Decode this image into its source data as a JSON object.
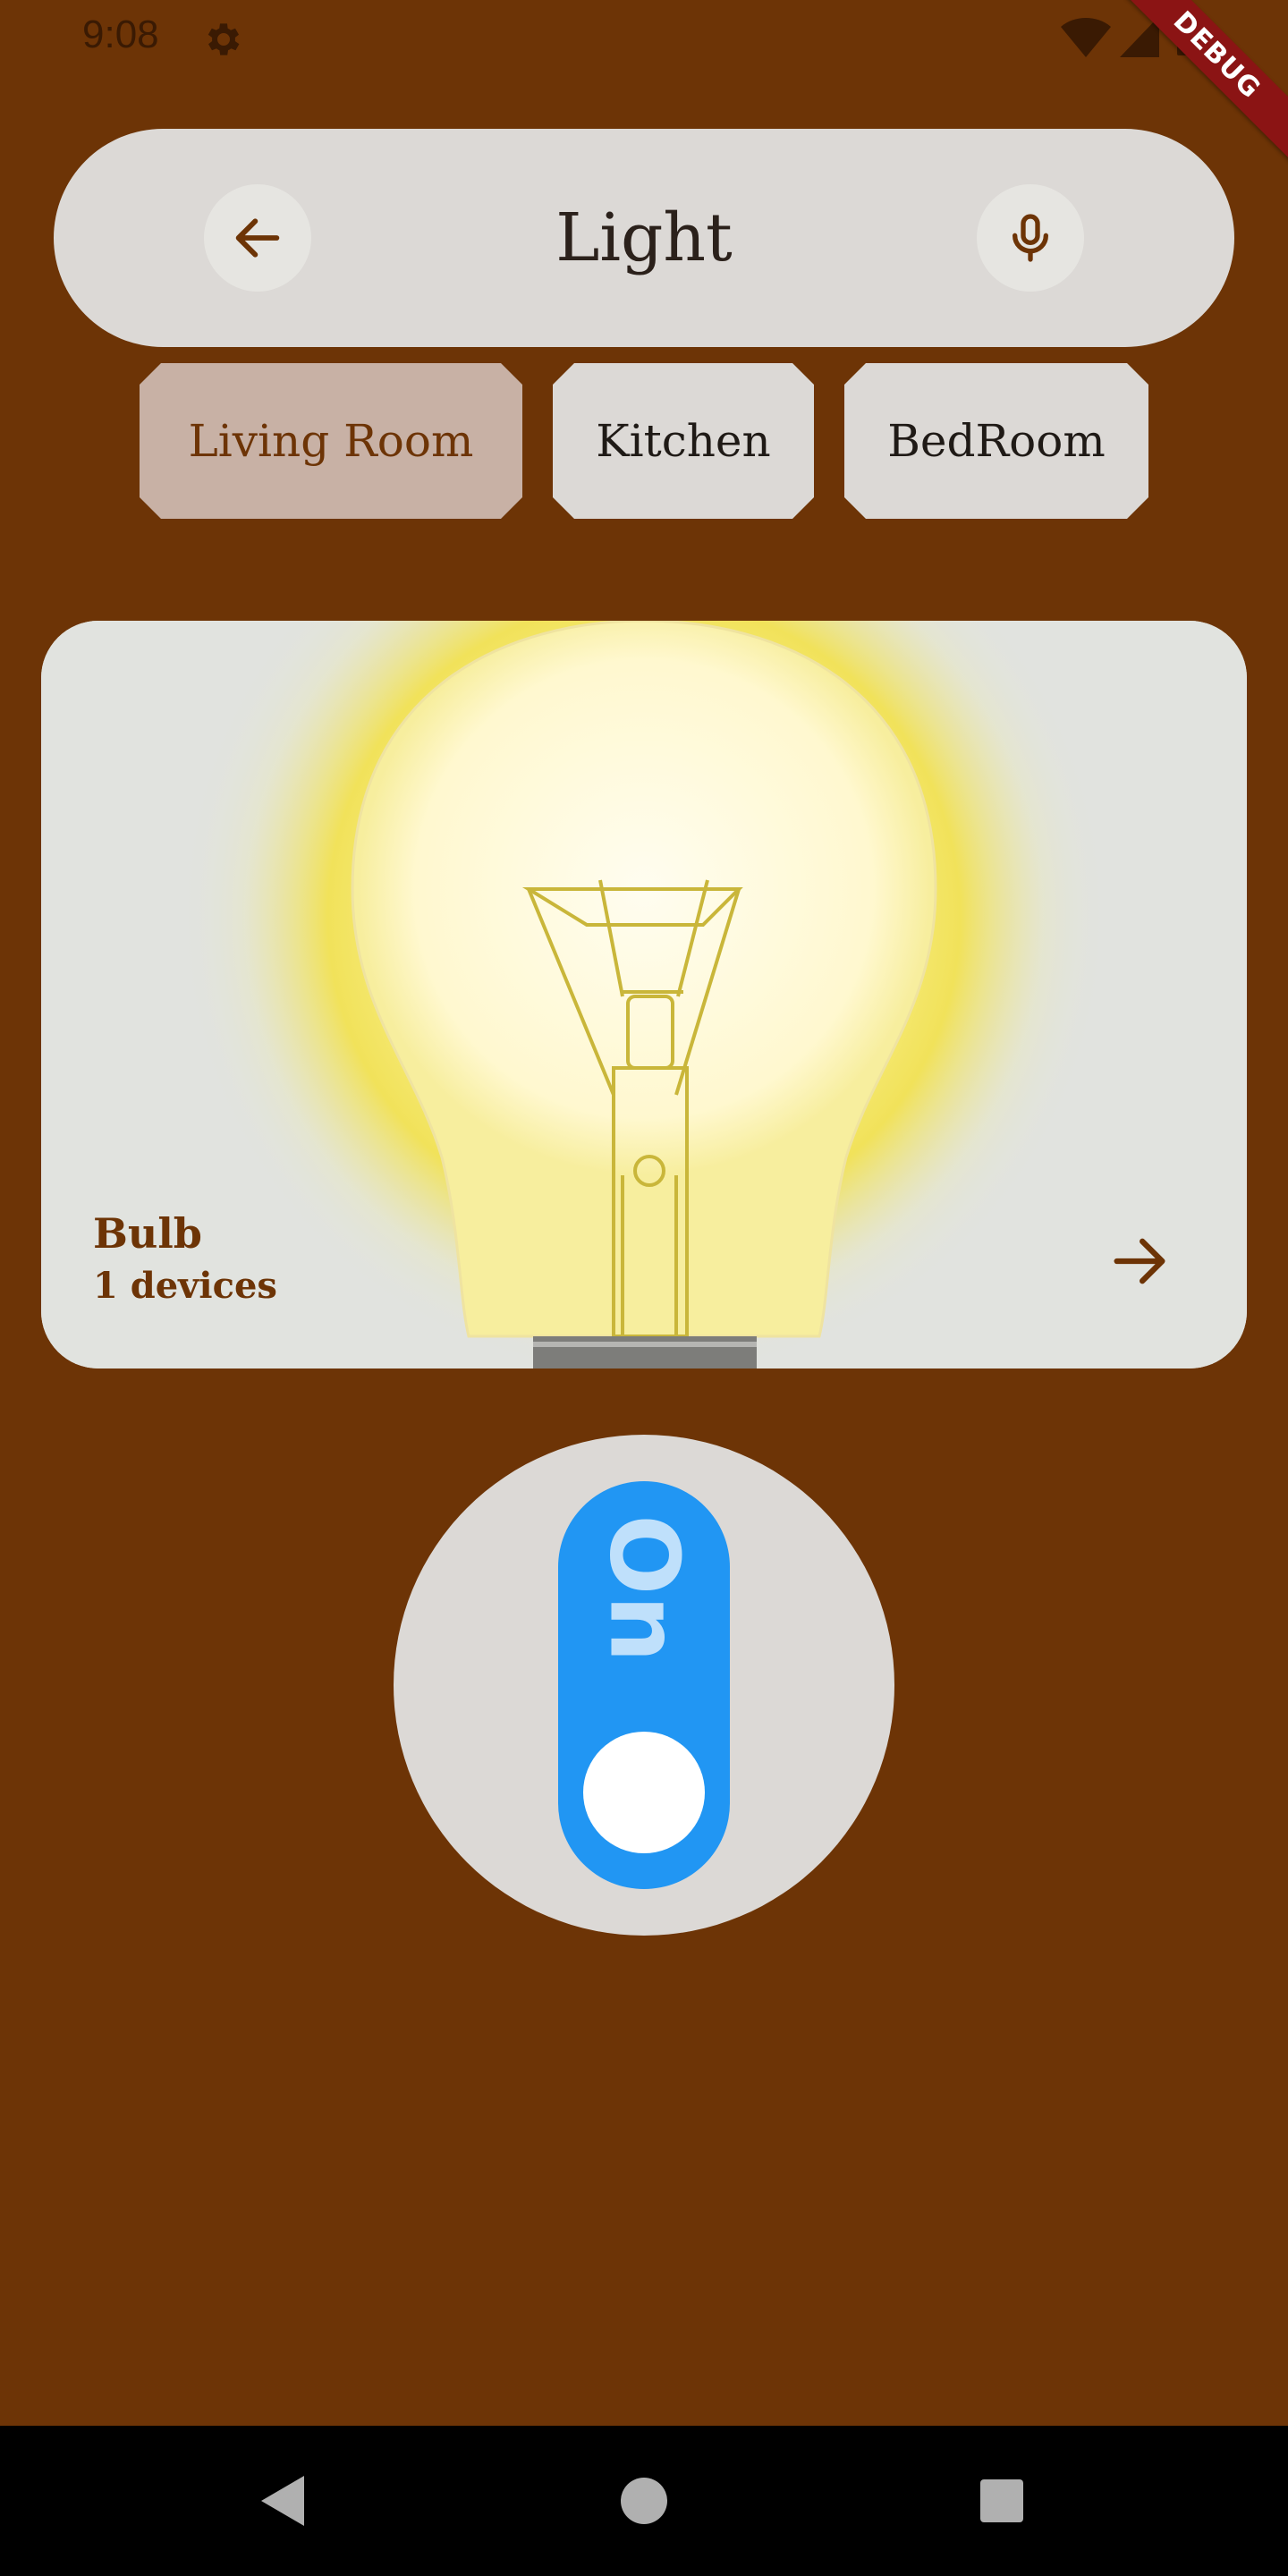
{
  "status_bar": {
    "time": "9:08",
    "icons": [
      "gear-icon",
      "wifi-icon",
      "signal-icon",
      "battery-icon"
    ]
  },
  "debug_banner": "DEBUG",
  "header": {
    "title": "Light",
    "back_icon": "arrow-left-icon",
    "mic_icon": "microphone-icon"
  },
  "rooms": [
    {
      "label": "Living Room",
      "selected": true
    },
    {
      "label": "Kitchen",
      "selected": false
    },
    {
      "label": "BedRoom",
      "selected": false
    }
  ],
  "device_card": {
    "name": "Bulb",
    "count": "1 devices",
    "arrow_icon": "arrow-right-icon",
    "image": "light-bulb-illustration"
  },
  "power_toggle": {
    "label": "On",
    "state": true
  },
  "nav_bar": {
    "buttons": [
      "back-triangle-icon",
      "home-circle-icon",
      "recents-square-icon"
    ]
  },
  "colors": {
    "background": "#6d3406",
    "surface": "#dcd9d6",
    "chip_selected": "#c8b1a5",
    "toggle": "#2196f3",
    "accent_text": "#6d3406"
  }
}
